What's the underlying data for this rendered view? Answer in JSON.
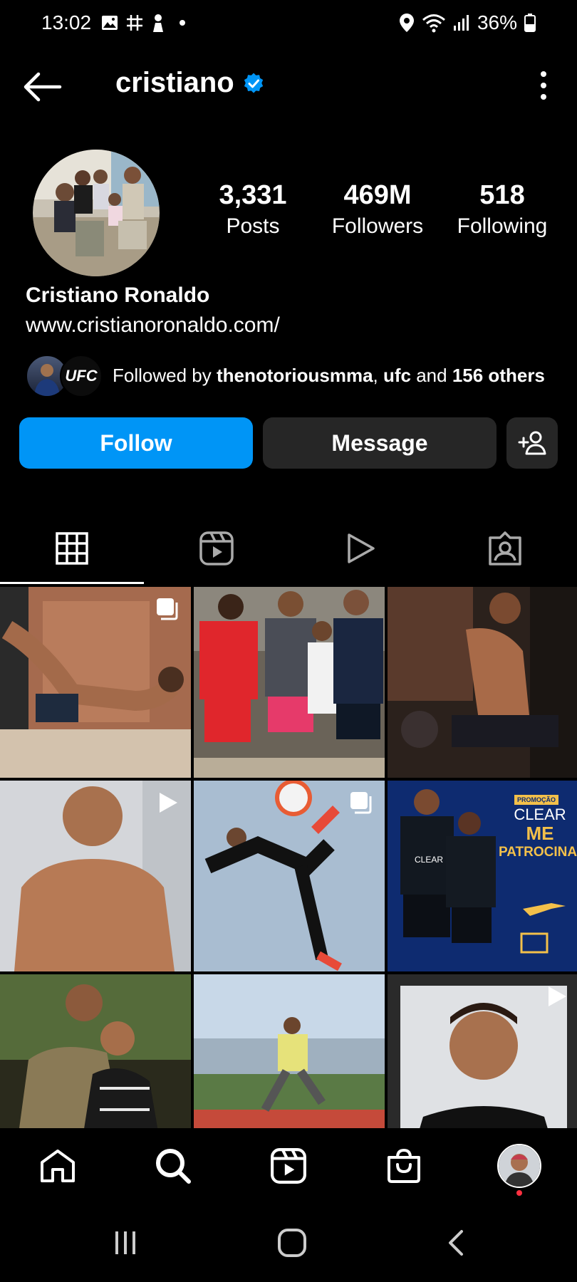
{
  "status_bar": {
    "time": "13:02",
    "battery": "36%"
  },
  "header": {
    "username": "cristiano"
  },
  "profile": {
    "stats": [
      {
        "num": "3,331",
        "label": "Posts"
      },
      {
        "num": "469M",
        "label": "Followers"
      },
      {
        "num": "518",
        "label": "Following"
      }
    ],
    "full_name": "Cristiano Ronaldo",
    "website": "www.cristianoronaldo.com/",
    "followed_by": {
      "prefix": "Followed by ",
      "user1": "thenotoriousmma",
      "sep": ", ",
      "user2": "ufc",
      "and": " and ",
      "others": "156 others",
      "badge_text": "UFC"
    }
  },
  "buttons": {
    "follow": "Follow",
    "message": "Message"
  },
  "posts": {
    "clear_ad": {
      "promo": "PROMOÇÃO",
      "line1": "CLEAR",
      "line2": "ME",
      "line3": "PATROCINA",
      "shirt": "CLEAR"
    }
  },
  "colors": {
    "accent": "#0095f6",
    "secondary_button": "#262626",
    "background": "#000000"
  }
}
